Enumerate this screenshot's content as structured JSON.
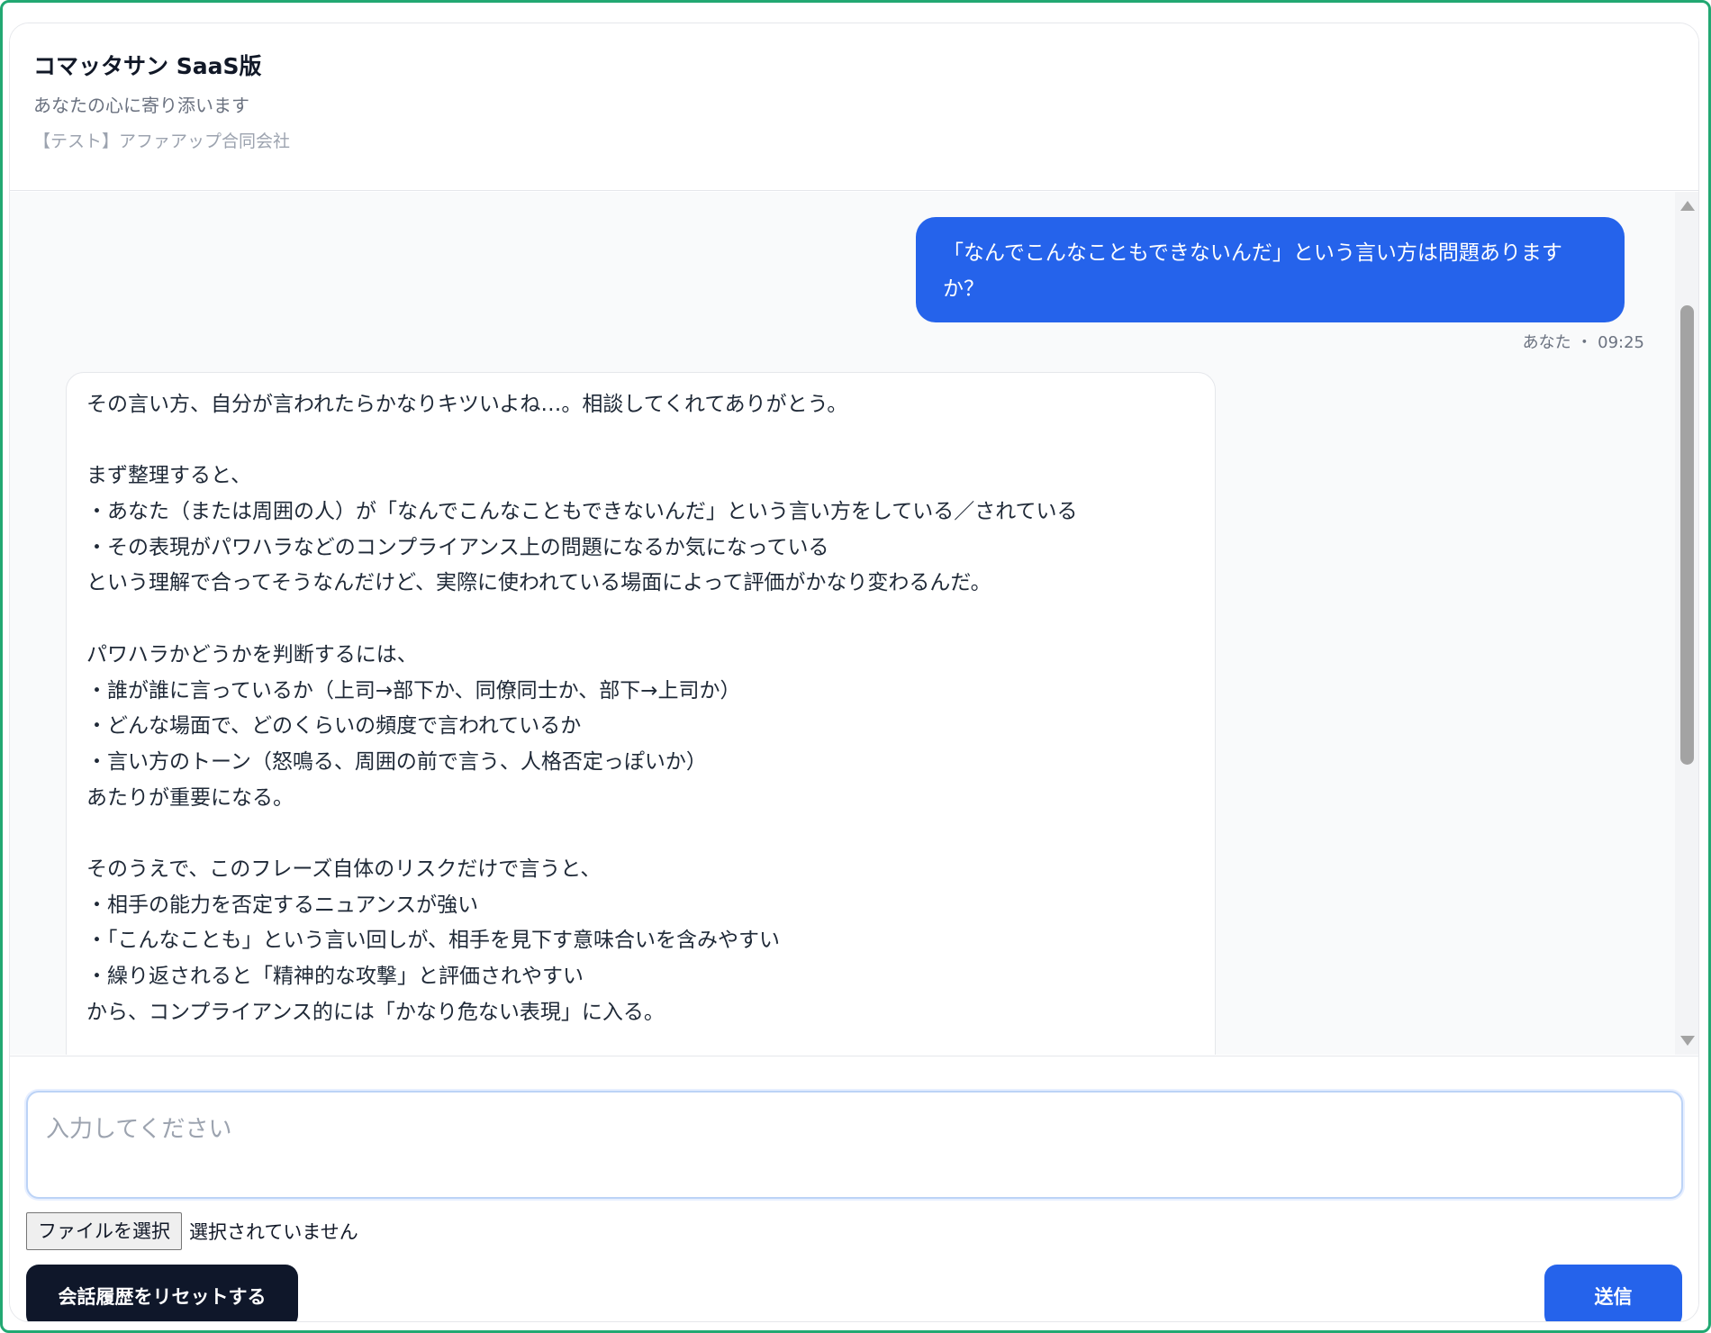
{
  "header": {
    "title": "コマッタサン SaaS版",
    "subtitle": "あなたの心に寄り添います",
    "company": "【テスト】アファアップ合同会社"
  },
  "chat": {
    "user_message": {
      "text": "「なんでこんなこともできないんだ」という言い方は問題ありますか？",
      "sender": "あなた",
      "time": "09:25",
      "meta": "あなた ・ 09:25"
    },
    "bot_message": {
      "lines": [
        "その言い方、自分が言われたらかなりキツいよね…。相談してくれてありがとう。",
        "",
        "まず整理すると、",
        "・あなた（または周囲の人）が「なんでこんなこともできないんだ」という言い方をしている／されている",
        "・その表現がパワハラなどのコンプライアンス上の問題になるか気になっている",
        "という理解で合ってそうなんだけど、実際に使われている場面によって評価がかなり変わるんだ。",
        "",
        "パワハラかどうかを判断するには、",
        "・誰が誰に言っているか（上司→部下か、同僚同士か、部下→上司か）",
        "・どんな場面で、どのくらいの頻度で言われているか",
        "・言い方のトーン（怒鳴る、周囲の前で言う、人格否定っぽいか）",
        "あたりが重要になる。",
        "",
        "そのうえで、このフレーズ自体のリスクだけで言うと、",
        "・相手の能力を否定するニュアンスが強い",
        "・「こんなことも」という言い回しが、相手を見下す意味合いを含みやすい",
        "・繰り返されると「精神的な攻撃」と評価されやすい",
        "から、コンプライアンス的には「かなり危ない表現」に入る。"
      ]
    }
  },
  "composer": {
    "placeholder": "入力してください",
    "file_button_label": "ファイルを選択",
    "file_status": "選択されていません",
    "reset_label": "会話履歴をリセットする",
    "send_label": "送信"
  },
  "colors": {
    "frame_border": "#22a872",
    "primary": "#2563eb",
    "dark_button": "#0f172a"
  }
}
